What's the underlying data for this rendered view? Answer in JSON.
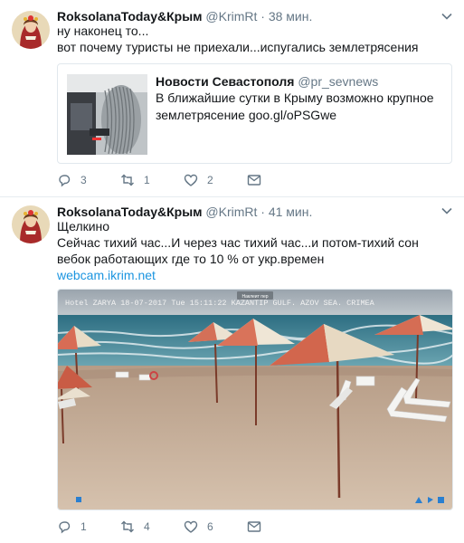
{
  "tweets": [
    {
      "name": "RoksolanaToday&Крым",
      "handle": "@KrimRt",
      "dot": "·",
      "time": "38 мин.",
      "lines": [
        "ну наконец то...",
        "вот почему туристы не приехали...испугались землетрясения"
      ],
      "quote": {
        "name": "Новости Севастополя",
        "handle": "@pr_sevnews",
        "text": "В ближайшие сутки в Крыму возможно крупное землетрясение",
        "link": "goo.gl/oPSGwe"
      },
      "actions": {
        "reply": "3",
        "retweet": "1",
        "like": "2"
      }
    },
    {
      "name": "RoksolanaToday&Крым",
      "handle": "@KrimRt",
      "dot": "·",
      "time": "41 мин.",
      "lines": [
        "Щелкино",
        "Сейчас тихий час...И через час тихий час...и потом-тихий сон",
        "вебок работающих где то 10 % от укр.времен"
      ],
      "link": "webcam.ikrim.net",
      "media": {
        "overlay": "Hotel ZARYA   18-07-2017 Tue 15:11:22 KAZANTIP GULF. AZOV SEA. CRIMEA",
        "badge": "Наклеит пер"
      },
      "actions": {
        "reply": "1",
        "retweet": "4",
        "like": "6"
      }
    }
  ],
  "icons": [
    "chevron-down-icon",
    "reply-icon",
    "retweet-icon",
    "like-icon",
    "dm-icon"
  ],
  "colors": {
    "link": "#1b95e0",
    "muted": "#657786",
    "border": "#e6ecf0"
  }
}
